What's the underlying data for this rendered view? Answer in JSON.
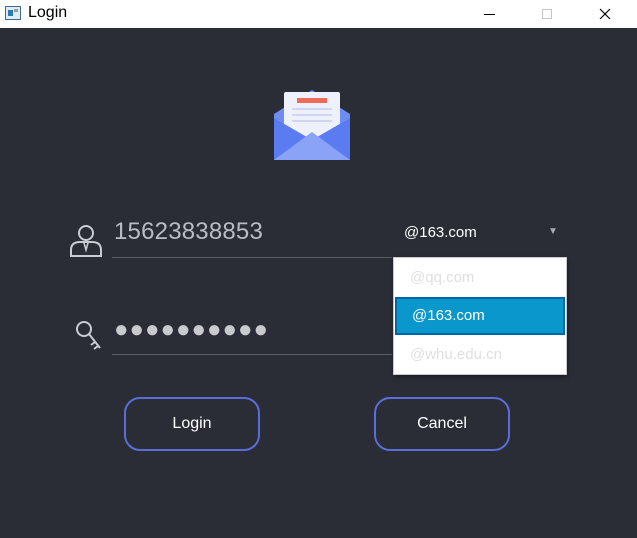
{
  "window": {
    "title": "Login",
    "controls": {
      "minimize": "minimize-icon",
      "maximize": "maximize-icon",
      "close": "×"
    }
  },
  "logo": {
    "icon": "envelope-open-icon",
    "colors": {
      "envelope": "#5b7cf0",
      "flap": "#8aa3f7",
      "paper": "#eef1fb",
      "accent": "#f06a5a"
    }
  },
  "form": {
    "account": {
      "icon": "user-icon",
      "value": "15623838853"
    },
    "domain": {
      "selected": "@163.com",
      "options": [
        "@qq.com",
        "@163.com",
        "@whu.edu.cn"
      ],
      "highlighted_index": 1
    },
    "password": {
      "icon": "key-icon",
      "masked_value": "●●●●●●●●●●"
    }
  },
  "buttons": {
    "login": "Login",
    "cancel": "Cancel"
  },
  "colors": {
    "background": "#2a2d36",
    "button_border": "#5b6dd6",
    "highlight": "#0a97cc"
  }
}
